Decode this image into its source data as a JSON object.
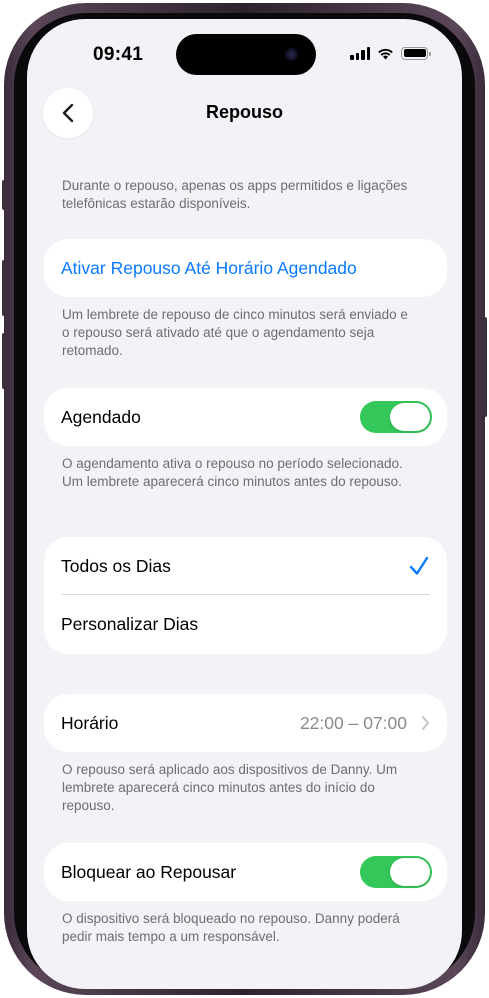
{
  "status_bar": {
    "time": "09:41"
  },
  "nav": {
    "title": "Repouso"
  },
  "intro_footnote": "Durante o repouso, apenas os apps permitidos e ligações telefônicas estarão disponíveis.",
  "activate_card": {
    "label": "Ativar Repouso Até Horário Agendado"
  },
  "activate_footnote": "Um lembrete de repouso de cinco minutos será enviado e o repouso será ativado até que o agendamento seja retomado.",
  "scheduled_card": {
    "label": "Agendado",
    "on": true
  },
  "scheduled_footnote": "O agendamento ativa o repouso no período selecionado. Um lembrete aparecerá cinco minutos antes do repouso.",
  "days_card": {
    "every_day": "Todos os Dias",
    "custom_days": "Personalizar Dias",
    "selected": "every_day"
  },
  "time_card": {
    "label": "Horário",
    "value": "22:00 – 07:00"
  },
  "time_footnote": "O repouso será aplicado aos dispositivos de Danny. Um lembrete aparecerá cinco minutos antes do início do repouso.",
  "lock_card": {
    "label": "Bloquear ao Repousar",
    "on": true
  },
  "lock_footnote": "O dispositivo será bloqueado no repouso. Danny poderá pedir mais tempo a um responsável.",
  "colors": {
    "accent": "#0a7aff",
    "toggle_on": "#34c759",
    "background": "#f2f2f7"
  },
  "icons": {
    "back": "chevron-left-icon",
    "check": "checkmark-icon",
    "disclosure": "chevron-right-icon"
  }
}
